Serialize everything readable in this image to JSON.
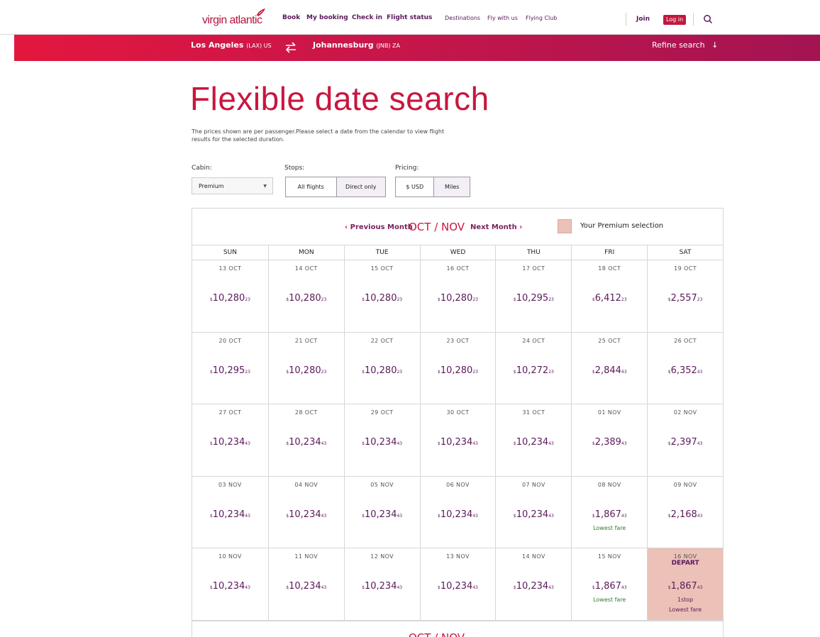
{
  "header": {
    "logo_text": "virgin atlantic",
    "nav_main": [
      "Book",
      "My booking",
      "Check in",
      "Flight status"
    ],
    "nav_secondary": [
      "Destinations",
      "Fly with us",
      "Flying Club"
    ],
    "join_label": "Join",
    "login_label": "Log in"
  },
  "route": {
    "from_city": "Los Angeles",
    "from_code": "(LAX) US",
    "to_city": "Johannesburg",
    "to_code": "(JNB) ZA",
    "refine_label": "Refine search"
  },
  "page": {
    "title": "Flexible date search",
    "description": "The prices shown are per passenger.Please select a date from the calendar to view flight results for the selected duration."
  },
  "filters": {
    "cabin_label": "Cabin:",
    "cabin_value": "Premium",
    "stops_label": "Stops:",
    "stops_options": [
      "All flights",
      "Direct only"
    ],
    "pricing_label": "Pricing:",
    "pricing_options": [
      "$ USD",
      "Miles"
    ]
  },
  "calendar": {
    "prev_label": "Previous Month",
    "month_label": "OCT / NOV",
    "next_label": "Next Month",
    "legend_label": "Your Premium selection",
    "days_of_week": [
      "SUN",
      "MON",
      "TUE",
      "WED",
      "THU",
      "FRI",
      "SAT"
    ],
    "currency_symbol": "$",
    "weeks": [
      [
        {
          "date": "13 OCT",
          "price": "10,280",
          "cents": "23"
        },
        {
          "date": "14 OCT",
          "price": "10,280",
          "cents": "23"
        },
        {
          "date": "15 OCT",
          "price": "10,280",
          "cents": "23"
        },
        {
          "date": "16 OCT",
          "price": "10,280",
          "cents": "23"
        },
        {
          "date": "17 OCT",
          "price": "10,295",
          "cents": "23"
        },
        {
          "date": "18 OCT",
          "price": "6,412",
          "cents": "23"
        },
        {
          "date": "19 OCT",
          "price": "2,557",
          "cents": "23"
        }
      ],
      [
        {
          "date": "20 OCT",
          "price": "10,295",
          "cents": "23"
        },
        {
          "date": "21 OCT",
          "price": "10,280",
          "cents": "23"
        },
        {
          "date": "22 OCT",
          "price": "10,280",
          "cents": "23"
        },
        {
          "date": "23 OCT",
          "price": "10,280",
          "cents": "23"
        },
        {
          "date": "24 OCT",
          "price": "10,272",
          "cents": "23"
        },
        {
          "date": "25 OCT",
          "price": "2,844",
          "cents": "43"
        },
        {
          "date": "26 OCT",
          "price": "6,352",
          "cents": "43"
        }
      ],
      [
        {
          "date": "27 OCT",
          "price": "10,234",
          "cents": "43"
        },
        {
          "date": "28 OCT",
          "price": "10,234",
          "cents": "43"
        },
        {
          "date": "29 OCT",
          "price": "10,234",
          "cents": "43"
        },
        {
          "date": "30 OCT",
          "price": "10,234",
          "cents": "43"
        },
        {
          "date": "31 OCT",
          "price": "10,234",
          "cents": "43"
        },
        {
          "date": "01 NOV",
          "price": "2,389",
          "cents": "43"
        },
        {
          "date": "02 NOV",
          "price": "2,397",
          "cents": "43"
        }
      ],
      [
        {
          "date": "03 NOV",
          "price": "10,234",
          "cents": "43"
        },
        {
          "date": "04 NOV",
          "price": "10,234",
          "cents": "43"
        },
        {
          "date": "05 NOV",
          "price": "10,234",
          "cents": "43"
        },
        {
          "date": "06 NOV",
          "price": "10,234",
          "cents": "43"
        },
        {
          "date": "07 NOV",
          "price": "10,234",
          "cents": "43"
        },
        {
          "date": "08 NOV",
          "price": "1,867",
          "cents": "43",
          "note": "Lowest fare"
        },
        {
          "date": "09 NOV",
          "price": "2,168",
          "cents": "43"
        }
      ],
      [
        {
          "date": "10 NOV",
          "price": "10,234",
          "cents": "43"
        },
        {
          "date": "11 NOV",
          "price": "10,234",
          "cents": "43"
        },
        {
          "date": "12 NOV",
          "price": "10,234",
          "cents": "43"
        },
        {
          "date": "13 NOV",
          "price": "10,234",
          "cents": "43"
        },
        {
          "date": "14 NOV",
          "price": "10,234",
          "cents": "43"
        },
        {
          "date": "15 NOV",
          "price": "1,867",
          "cents": "43",
          "note": "Lowest fare"
        },
        {
          "date": "16 NOV",
          "price": "1,867",
          "cents": "43",
          "note": "Lowest fare",
          "depart": "DEPART",
          "stops": "1stop",
          "selected": true
        }
      ]
    ],
    "footer_month_label": "OCT / NOV"
  },
  "colors": {
    "brand_red": "#c8163f",
    "brand_purple": "#5a1a5a",
    "selection": "#ecc1b8",
    "lowest_fare": "#2f7d2b"
  }
}
